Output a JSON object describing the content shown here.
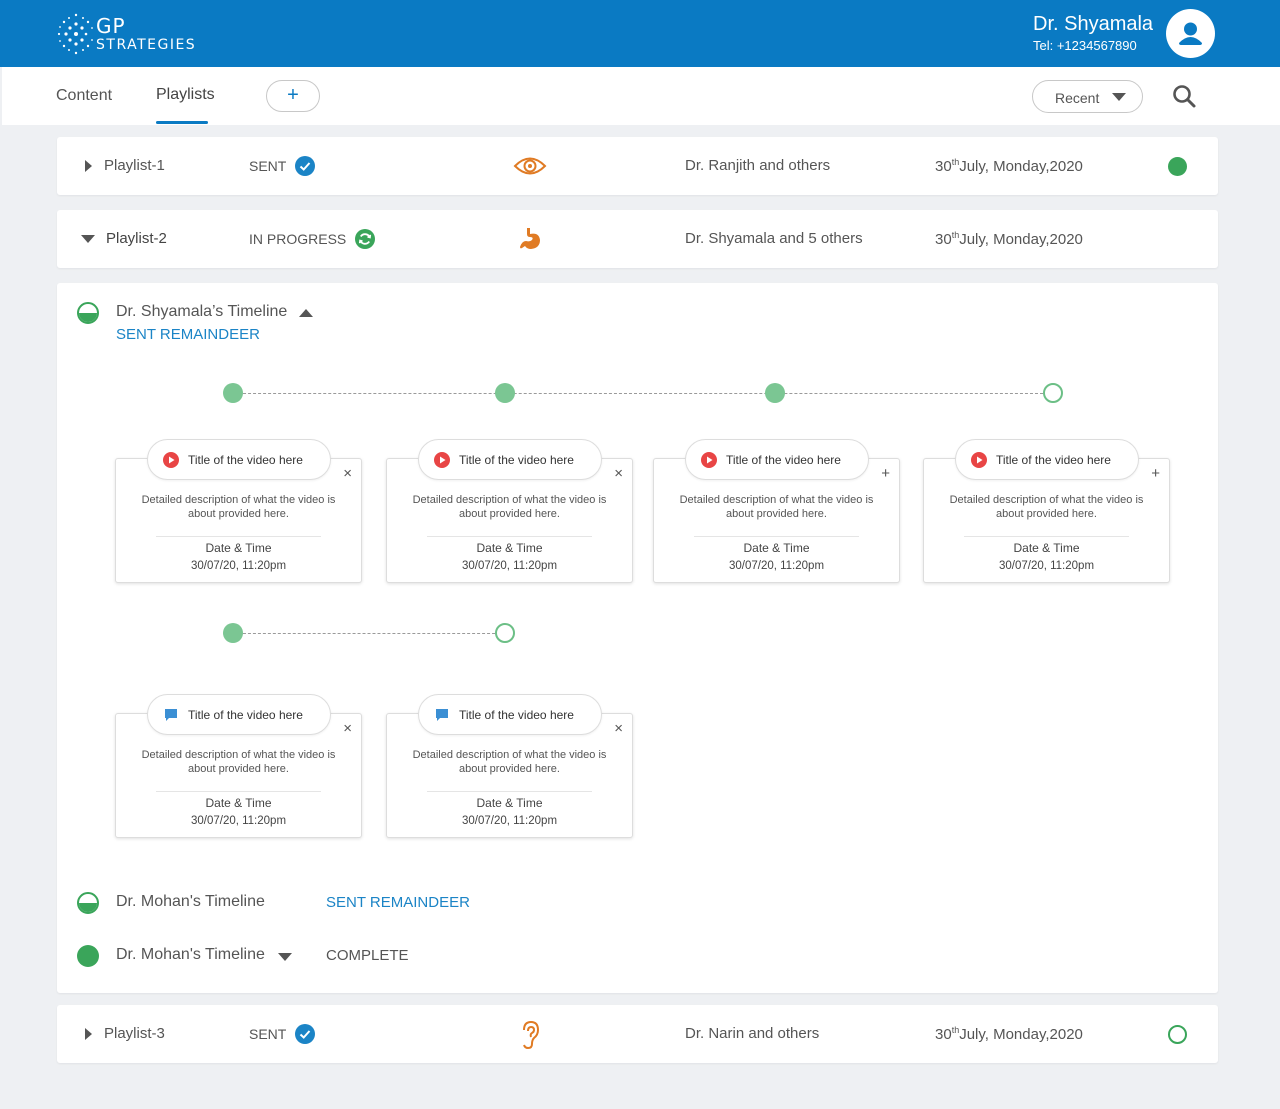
{
  "header": {
    "logo_line1": "GP",
    "logo_line2": "STRATEGIES",
    "user_name": "Dr. Shyamala",
    "user_tel": "Tel: +1234567890",
    "brand_color": "#0a7ac3"
  },
  "toolbar": {
    "tabs": [
      {
        "label": "Content",
        "active": false
      },
      {
        "label": "Playlists",
        "active": true
      }
    ],
    "add_label": "+",
    "sort_label": "Recent"
  },
  "playlists": [
    {
      "name": "Playlist-1",
      "status": "SENT",
      "status_icon": "check-circle-icon",
      "type_icon": "eye-icon",
      "who": "Dr. Ranjith and others",
      "date_day": "30",
      "date_sup": "th",
      "date_rest": "July, Monday,2020",
      "dot": "filled",
      "expanded": false
    },
    {
      "name": "Playlist-2",
      "status": "IN PROGRESS",
      "status_icon": "sync-icon",
      "type_icon": "stomach-icon",
      "who": "Dr. Shyamala and 5 others",
      "date_day": "30",
      "date_sup": "th",
      "date_rest": "July, Monday,2020",
      "dot": "none",
      "expanded": true
    },
    {
      "name": "Playlist-3",
      "status": "SENT",
      "status_icon": "check-circle-icon",
      "type_icon": "ear-icon",
      "who": "Dr. Narin and others",
      "date_day": "30",
      "date_sup": "th",
      "date_rest": "July, Monday,2020",
      "dot": "empty",
      "expanded": false
    }
  ],
  "expanded": {
    "timeline1": {
      "title": "Dr. Shyamala’s Timeline",
      "action": "SENT REMAINDEER"
    },
    "cards_row1": [
      {
        "title": "Title of the video here",
        "desc": "Detailed description of what the video is about provided here.",
        "dt_label": "Date & Time",
        "dt_value": "30/07/20, 11:20pm",
        "action": "×",
        "icon": "play-icon"
      },
      {
        "title": "Title of the video here",
        "desc": "Detailed description of what the video is about provided here.",
        "dt_label": "Date & Time",
        "dt_value": "30/07/20, 11:20pm",
        "action": "×",
        "icon": "play-icon"
      },
      {
        "title": "Title of the video here",
        "desc": "Detailed description of what the video is about provided here.",
        "dt_label": "Date & Time",
        "dt_value": "30/07/20, 11:20pm",
        "action": "+",
        "icon": "play-icon"
      },
      {
        "title": "Title of the video here",
        "desc": "Detailed description of what the video is about provided here.",
        "dt_label": "Date & Time",
        "dt_value": "30/07/20, 11:20pm",
        "action": "+",
        "icon": "play-icon"
      }
    ],
    "cards_row2": [
      {
        "title": "Title of the video here",
        "desc": "Detailed description of what the video is about provided here.",
        "dt_label": "Date & Time",
        "dt_value": "30/07/20, 11:20pm",
        "action": "×",
        "icon": "chat-icon"
      },
      {
        "title": "Title of the video here",
        "desc": "Detailed description of what the video is about provided here.",
        "dt_label": "Date & Time",
        "dt_value": "30/07/20, 11:20pm",
        "action": "×",
        "icon": "chat-icon"
      }
    ],
    "timeline2": {
      "title": "Dr. Mohan's Timeline",
      "action": "SENT REMAINDEER"
    },
    "timeline3": {
      "title": "Dr. Mohan's Timeline",
      "status": "COMPLETE"
    }
  },
  "colors": {
    "green": "#3aa55a",
    "node_green": "#7bc693",
    "blue_link": "#1b84c6",
    "orange_icon": "#e07b24",
    "play_red": "#e84545",
    "chat_blue": "#3b8fd4"
  }
}
